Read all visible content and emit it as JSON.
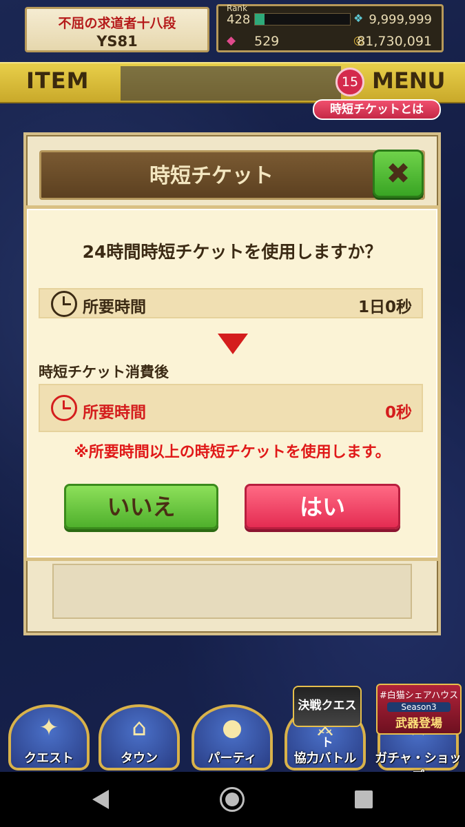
{
  "status": {
    "rank_title": "不屈の求道者十八段",
    "player_name": "YS81",
    "rank_label": "Rank",
    "rank_value": "428",
    "exp_progress": 0.1,
    "stamina": "9,999,999",
    "gems": "529",
    "coins": "81,730,091"
  },
  "header": {
    "item_label": "ITEM",
    "menu_badge": "15",
    "menu_label": "MENU",
    "info_pill": "時短チケットとは"
  },
  "dialog": {
    "title": "時短チケット",
    "close_icon": "close-x-icon",
    "question": "24時間時短チケットを使用しますか？",
    "required_time_label": "所要時間",
    "required_time_value": "1日0秒",
    "after_label": "時短チケット消費後",
    "after_time_label": "所要時間",
    "after_time_value": "0秒",
    "warning": "※所要時間以上の時短チケットを使用します。",
    "no_label": "いいえ",
    "yes_label": "はい",
    "colors": {
      "no": "#4fb02c",
      "yes": "#e42c52",
      "warning": "#e01818"
    }
  },
  "bottom_nav": {
    "items": [
      {
        "label": "クエスト",
        "icon": "quest-icon"
      },
      {
        "label": "タウン",
        "icon": "town-icon"
      },
      {
        "label": "パーティ",
        "icon": "party-icon"
      },
      {
        "label": "協力バトル",
        "icon": "coop-battle-icon"
      },
      {
        "label": "ガチャ・ショップ",
        "icon": "gacha-shop-icon"
      }
    ],
    "event_banner": "決戦クエスト",
    "share_tag": "#白猫シェアハウス",
    "season": "Season3",
    "weapon": "武器登場"
  }
}
